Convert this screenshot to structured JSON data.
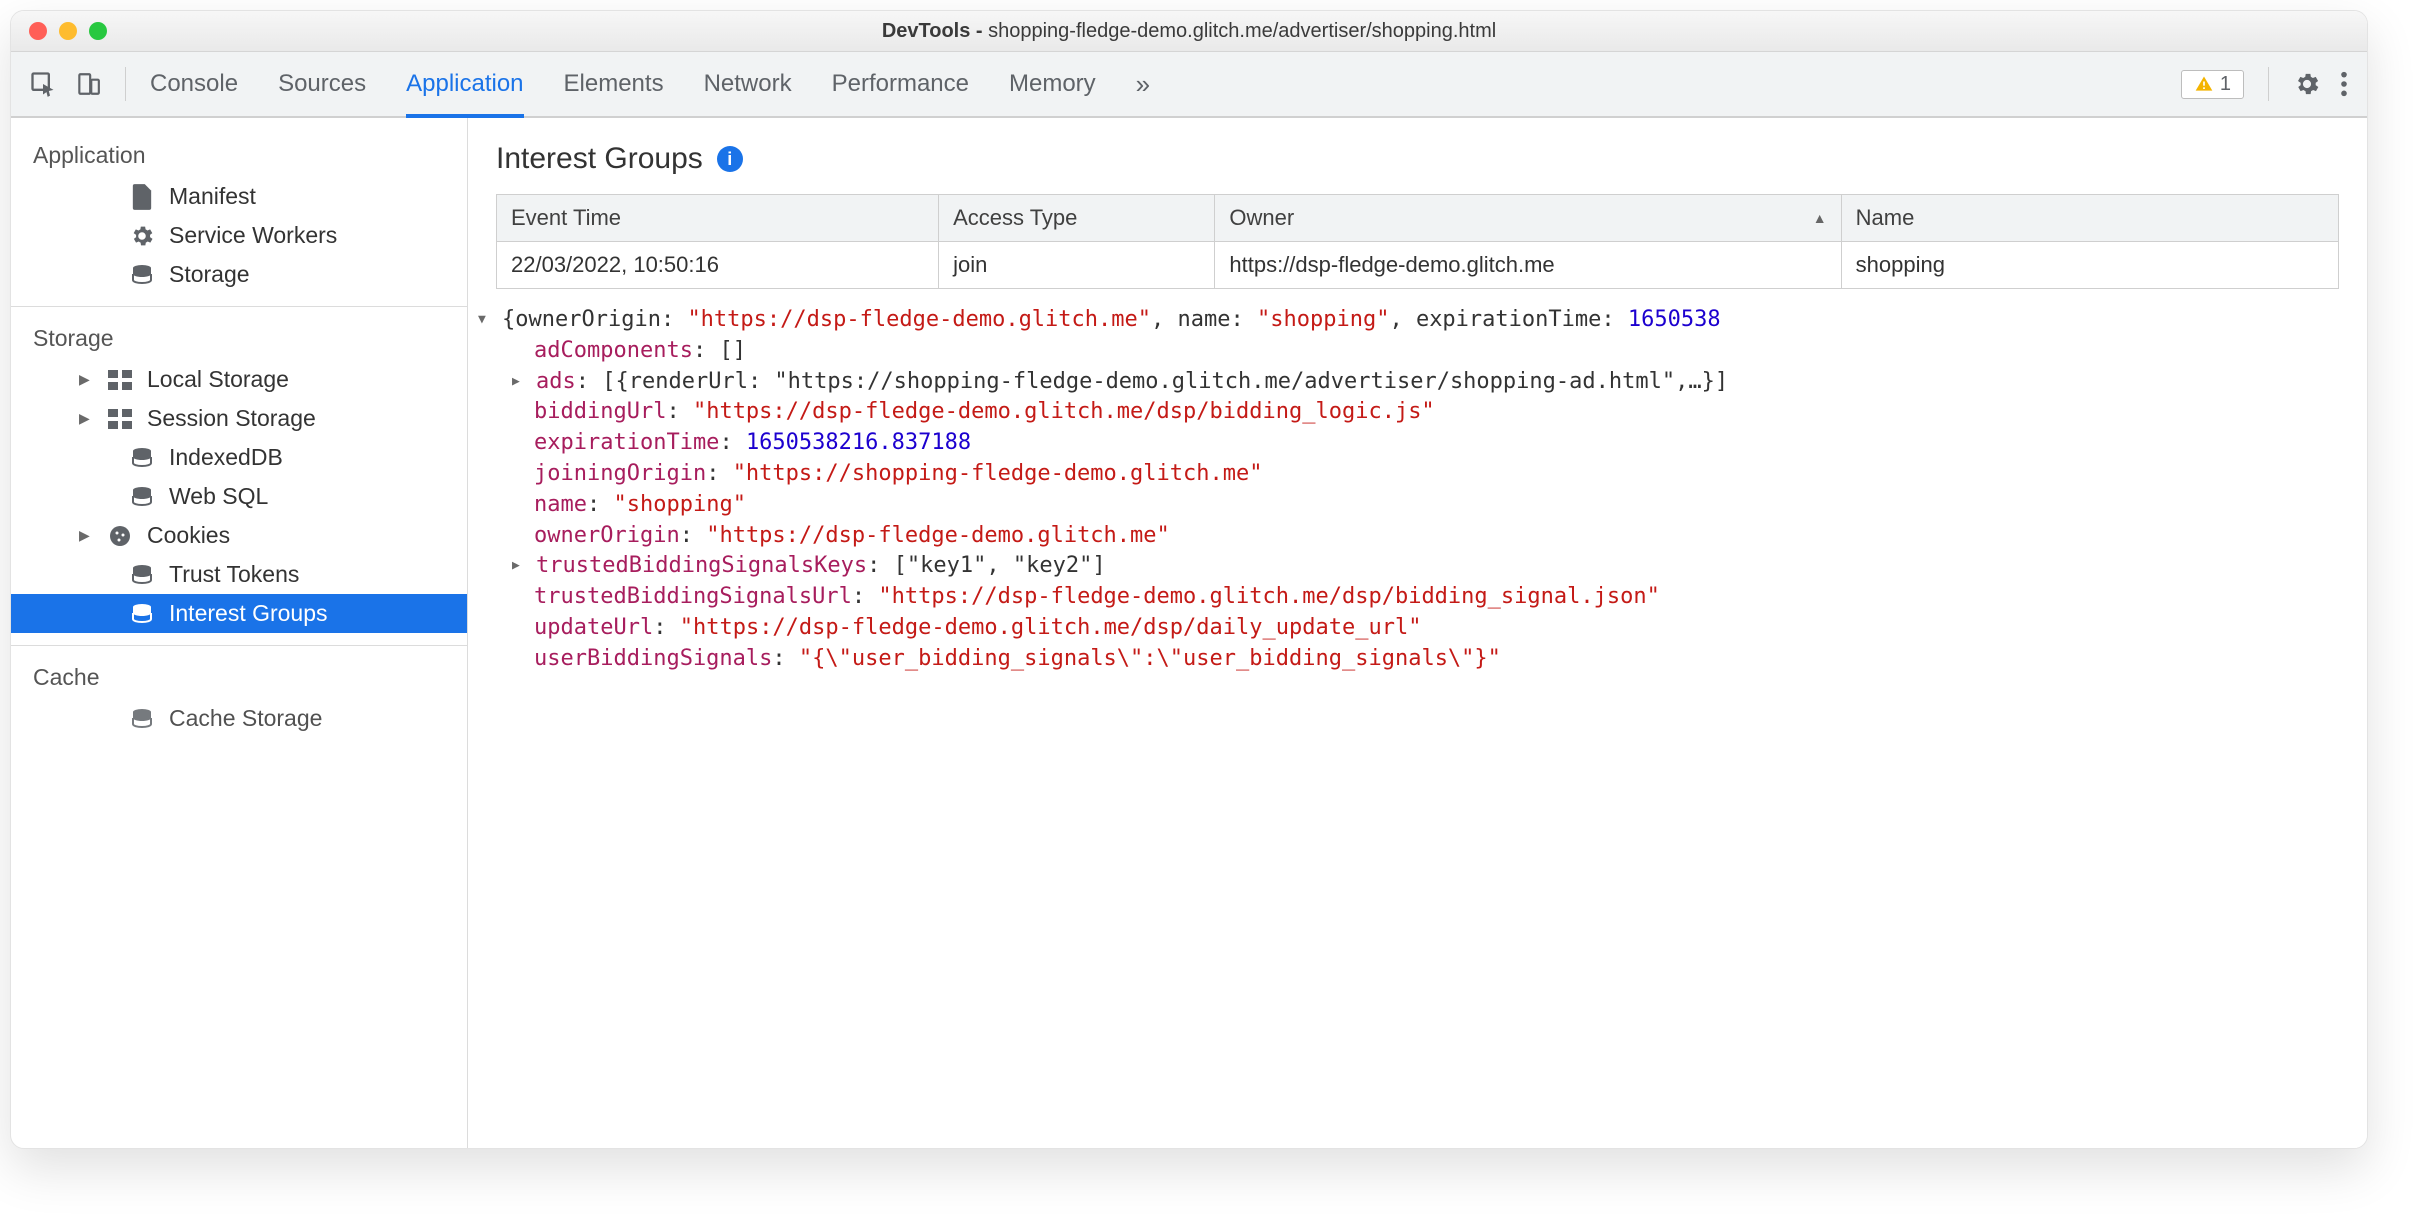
{
  "window": {
    "title_prefix": "DevTools - ",
    "title_path": "shopping-fledge-demo.glitch.me/advertiser/shopping.html"
  },
  "toolbar": {
    "tabs": [
      "Console",
      "Sources",
      "Application",
      "Elements",
      "Network",
      "Performance",
      "Memory"
    ],
    "active_tab": "Application",
    "warn_count": "1"
  },
  "sidebar": {
    "sections": [
      {
        "title": "Application",
        "items": [
          {
            "icon": "file",
            "label": "Manifest",
            "expandable": false
          },
          {
            "icon": "gear",
            "label": "Service Workers",
            "expandable": false
          },
          {
            "icon": "db",
            "label": "Storage",
            "expandable": false
          }
        ]
      },
      {
        "title": "Storage",
        "items": [
          {
            "icon": "grid",
            "label": "Local Storage",
            "expandable": true
          },
          {
            "icon": "grid",
            "label": "Session Storage",
            "expandable": true
          },
          {
            "icon": "db",
            "label": "IndexedDB",
            "expandable": false
          },
          {
            "icon": "db",
            "label": "Web SQL",
            "expandable": false
          },
          {
            "icon": "cookie",
            "label": "Cookies",
            "expandable": true
          },
          {
            "icon": "db",
            "label": "Trust Tokens",
            "expandable": false
          },
          {
            "icon": "db",
            "label": "Interest Groups",
            "expandable": false,
            "selected": true
          }
        ]
      },
      {
        "title": "Cache",
        "items": [
          {
            "icon": "db",
            "label": "Cache Storage",
            "expandable": false
          }
        ]
      }
    ]
  },
  "main": {
    "heading": "Interest Groups",
    "table": {
      "headers": [
        "Event Time",
        "Access Type",
        "Owner",
        "Name"
      ],
      "sorted_col": 2,
      "rows": [
        {
          "event_time": "22/03/2022, 10:50:16",
          "access_type": "join",
          "owner": "https://dsp-fledge-demo.glitch.me",
          "name": "shopping"
        }
      ]
    },
    "object": {
      "summary": {
        "ownerOrigin": "\"https://dsp-fledge-demo.glitch.me\"",
        "name": "\"shopping\"",
        "expirationTime_trunc": "1650538"
      },
      "props": {
        "adComponents": "[]",
        "ads_collapsed": "[{renderUrl: \"https://shopping-fledge-demo.glitch.me/advertiser/shopping-ad.html\",…}]",
        "biddingUrl": "\"https://dsp-fledge-demo.glitch.me/dsp/bidding_logic.js\"",
        "expirationTime": "1650538216.837188",
        "joiningOrigin": "\"https://shopping-fledge-demo.glitch.me\"",
        "name": "\"shopping\"",
        "ownerOrigin": "\"https://dsp-fledge-demo.glitch.me\"",
        "trustedBiddingSignalsKeys": "[\"key1\", \"key2\"]",
        "trustedBiddingSignalsUrl": "\"https://dsp-fledge-demo.glitch.me/dsp/bidding_signal.json\"",
        "updateUrl": "\"https://dsp-fledge-demo.glitch.me/dsp/daily_update_url\"",
        "userBiddingSignals": "\"{\\\"user_bidding_signals\\\":\\\"user_bidding_signals\\\"}\""
      }
    }
  }
}
